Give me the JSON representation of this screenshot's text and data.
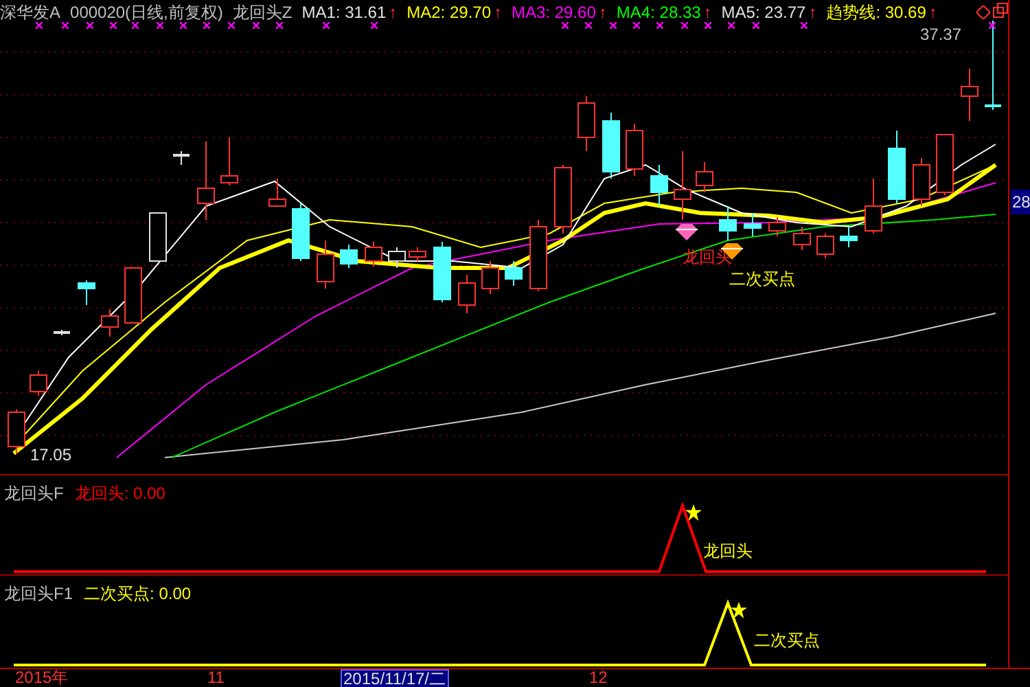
{
  "header": {
    "stock": "深华发A",
    "code": "000020(日线,前复权)",
    "indicator": "龙回头Z",
    "averages": [
      {
        "label": "MA1:",
        "value": "31.61",
        "arrow": "↑",
        "color": "#e0e0e0"
      },
      {
        "label": "MA2:",
        "value": "29.70",
        "arrow": "↑",
        "color": "#ffff00"
      },
      {
        "label": "MA3:",
        "value": "29.60",
        "arrow": "↑",
        "color": "#ff00ff"
      },
      {
        "label": "MA4:",
        "value": "28.33",
        "arrow": "↑",
        "color": "#00ff00"
      },
      {
        "label": "MA5:",
        "value": "23.77",
        "arrow": "↑",
        "color": "#e0e0e0"
      },
      {
        "label": "趋势线:",
        "value": "30.69",
        "arrow": "↑",
        "color": "#ffff00"
      }
    ]
  },
  "main_chart": {
    "high_label": "37.37",
    "low_label": "17.05",
    "price_tag": "28",
    "signals": [
      {
        "kind": "dragon",
        "label": "龙回头"
      },
      {
        "kind": "buy",
        "label": "二次买点"
      }
    ]
  },
  "panels": [
    {
      "title": "龙回头F",
      "series": "龙回头:",
      "value": "0.00",
      "color": "#ff0000",
      "peak_label": "龙回头"
    },
    {
      "title": "龙回头F1",
      "series": "二次买点:",
      "value": "0.00",
      "color": "#ffff00",
      "peak_label": "二次买点"
    }
  ],
  "date_axis": [
    {
      "label": "2015年",
      "selected": false
    },
    {
      "label": "11",
      "selected": false
    },
    {
      "label": "2015/11/17/二",
      "selected": true
    },
    {
      "label": "12",
      "selected": false
    }
  ]
}
